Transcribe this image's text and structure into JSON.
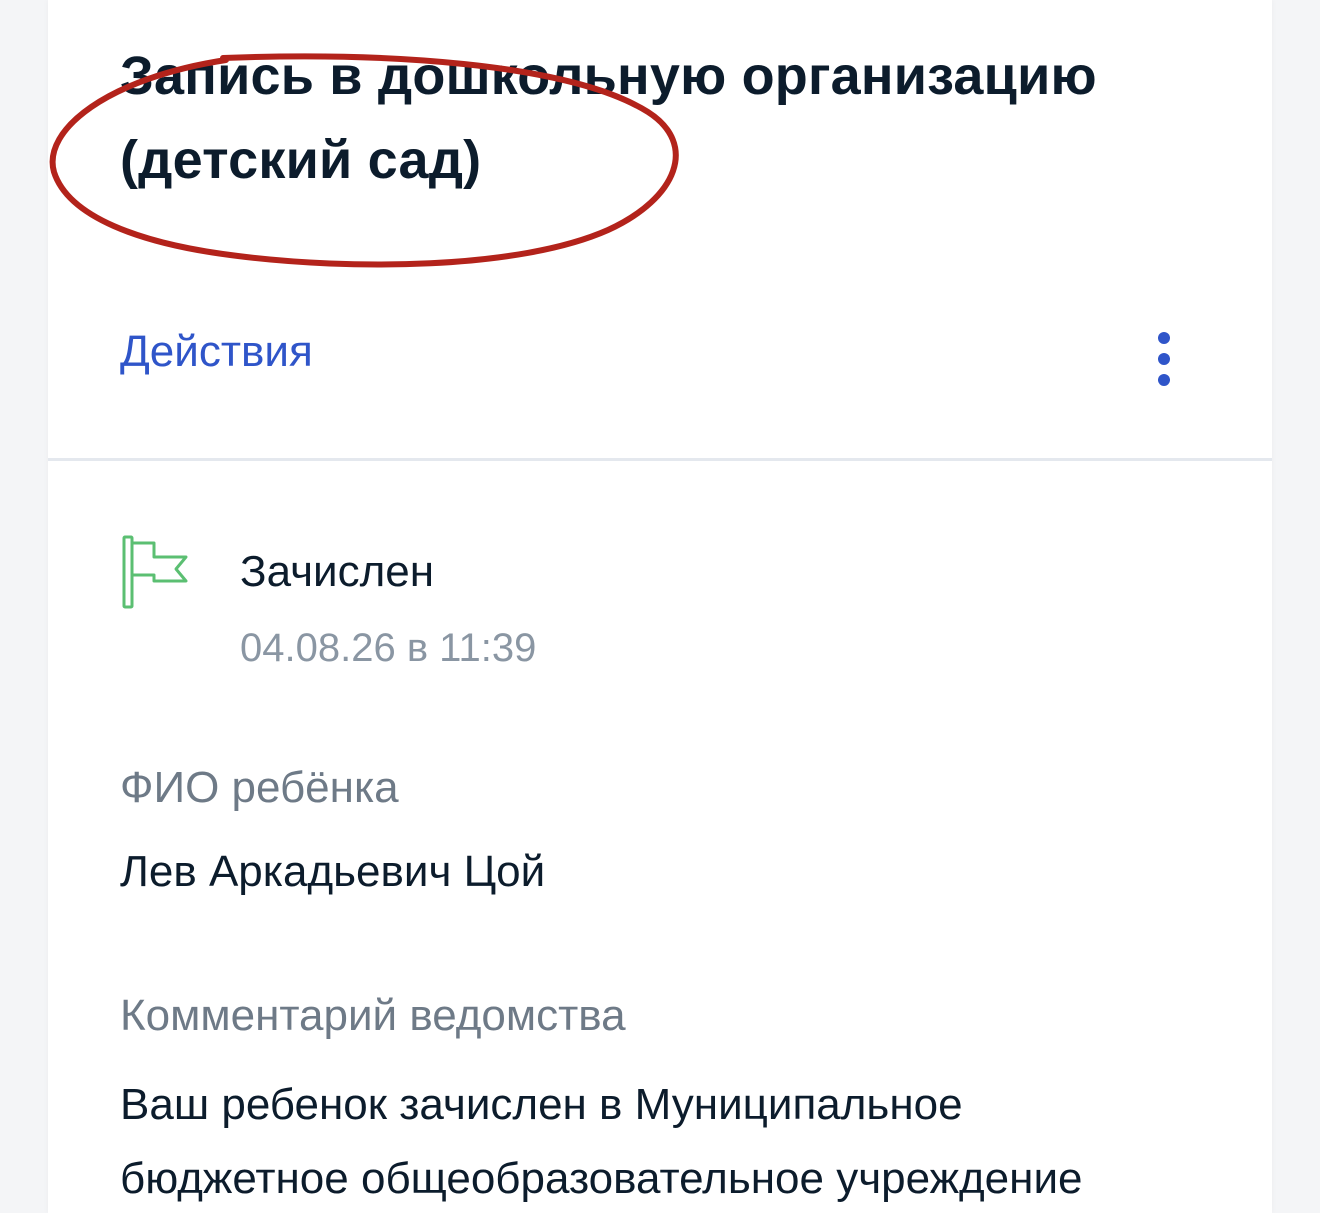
{
  "header": {
    "title_line1": "Запись в дошкольную организацию",
    "title_line2": "(детский сад)"
  },
  "actions": {
    "label": "Действия",
    "more_icon": "more-vertical-icon"
  },
  "status": {
    "icon": "flag-icon",
    "label": "Зачислен",
    "date": "04.08.26 в 11:39"
  },
  "child": {
    "label": "ФИО ребёнка",
    "value": "Лев Аркадьевич Цой"
  },
  "comment": {
    "label": "Комментарий ведомства",
    "line1": "Ваш ребенок зачислен в Муниципальное",
    "line2": "бюджетное общеобразовательное учреждение"
  },
  "colors": {
    "accent": "#2f55c9",
    "status_green": "#5bbf72",
    "annotation_red": "#b3231b"
  }
}
